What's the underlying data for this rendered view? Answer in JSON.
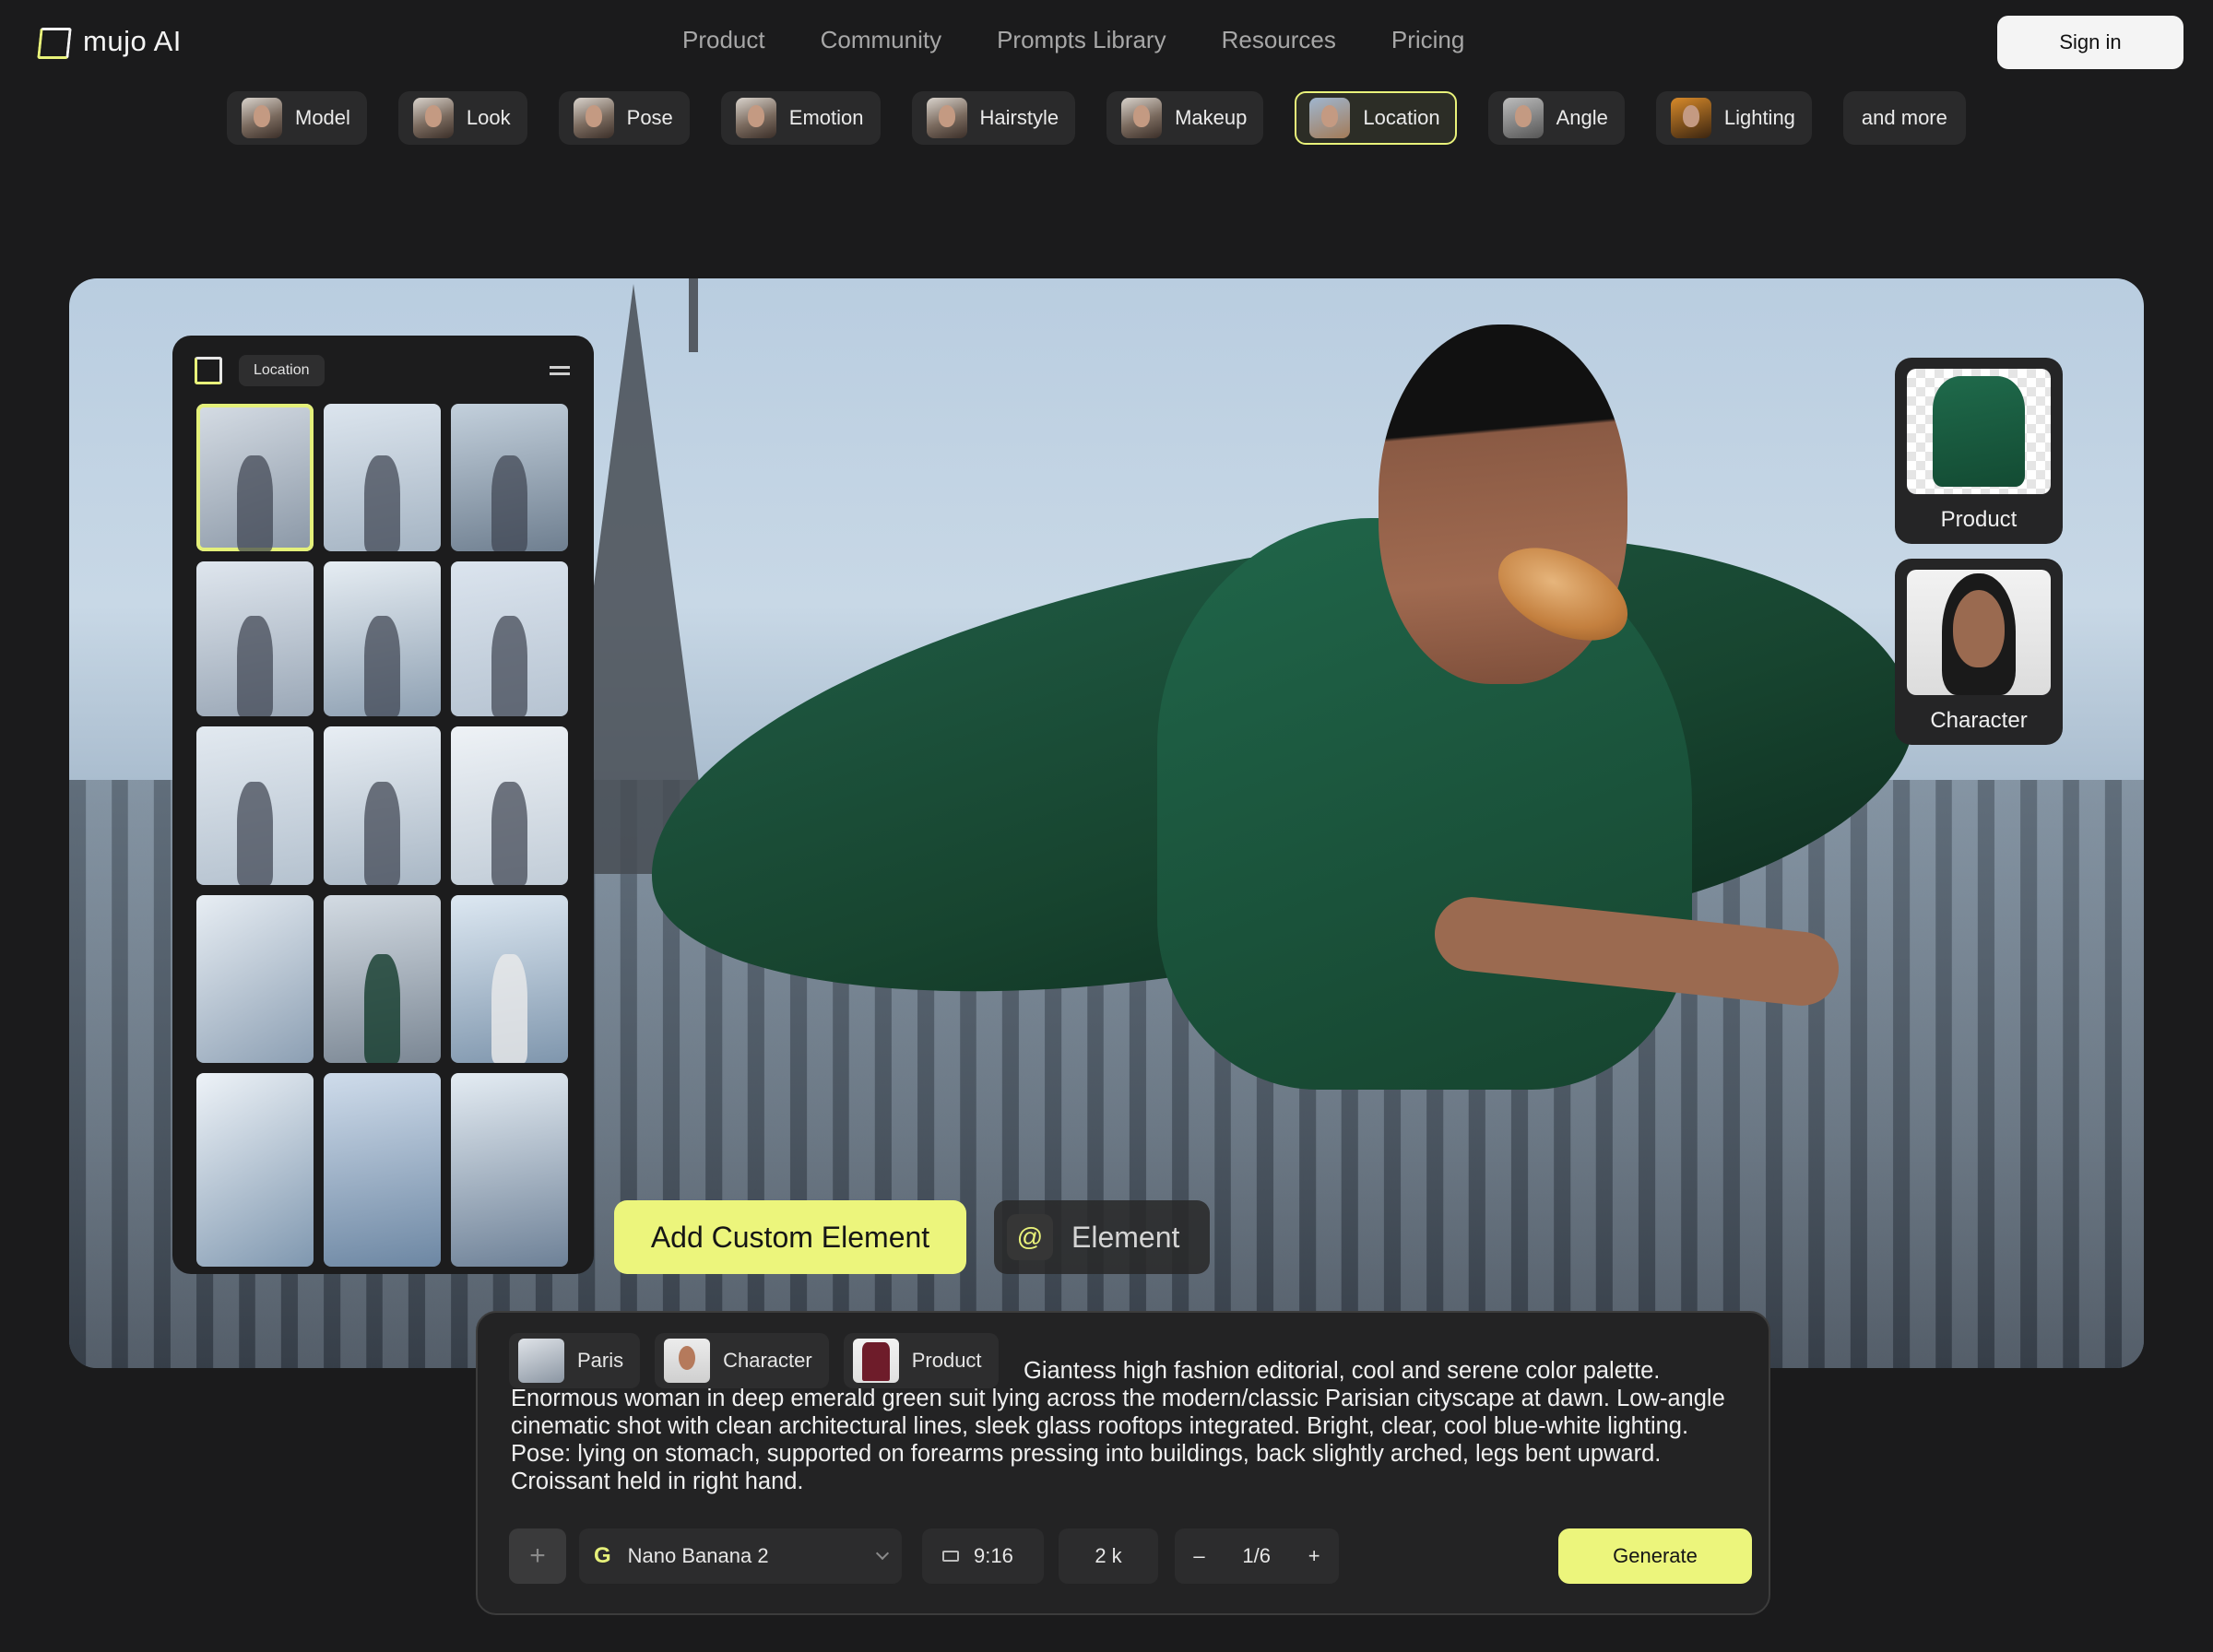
{
  "brand": {
    "name": "mujo AI"
  },
  "nav": {
    "items": [
      "Product",
      "Community",
      "Prompts Library",
      "Resources",
      "Pricing"
    ],
    "signin": "Sign in"
  },
  "categories": [
    "Model",
    "Look",
    "Pose",
    "Emotion",
    "Hairstyle",
    "Makeup",
    "Location",
    "Angle",
    "Lighting",
    "and more"
  ],
  "active_category": "Location",
  "location_panel": {
    "label": "Location",
    "thumbnails": 15,
    "selected_index": 0
  },
  "side_cards": {
    "product": "Product",
    "character": "Character"
  },
  "custom": {
    "add_label": "Add Custom Element",
    "element_label": "Element",
    "at_symbol": "@"
  },
  "prompt": {
    "tags": [
      "Paris",
      "Character",
      "Product"
    ],
    "text": "Giantess high fashion editorial, cool and serene color palette. Enormous woman in deep emerald green suit lying across the modern/classic Parisian cityscape at dawn. Low-angle cinematic shot with clean architectural lines, sleek glass rooftops integrated. Bright, clear, cool blue-white lighting. Pose: lying on stomach, supported on forearms pressing into buildings, back slightly arched, legs bent upward. Croissant held in right hand."
  },
  "controls": {
    "plus": "+",
    "model_icon": "G",
    "model": "Nano Banana 2",
    "ratio": "9:16",
    "resolution": "2 k",
    "minus": "–",
    "count": "1/6",
    "increment": "+",
    "generate": "Generate"
  },
  "colors": {
    "accent": "#ECF57C",
    "background": "#1B1B1C",
    "panel": "#232324"
  }
}
